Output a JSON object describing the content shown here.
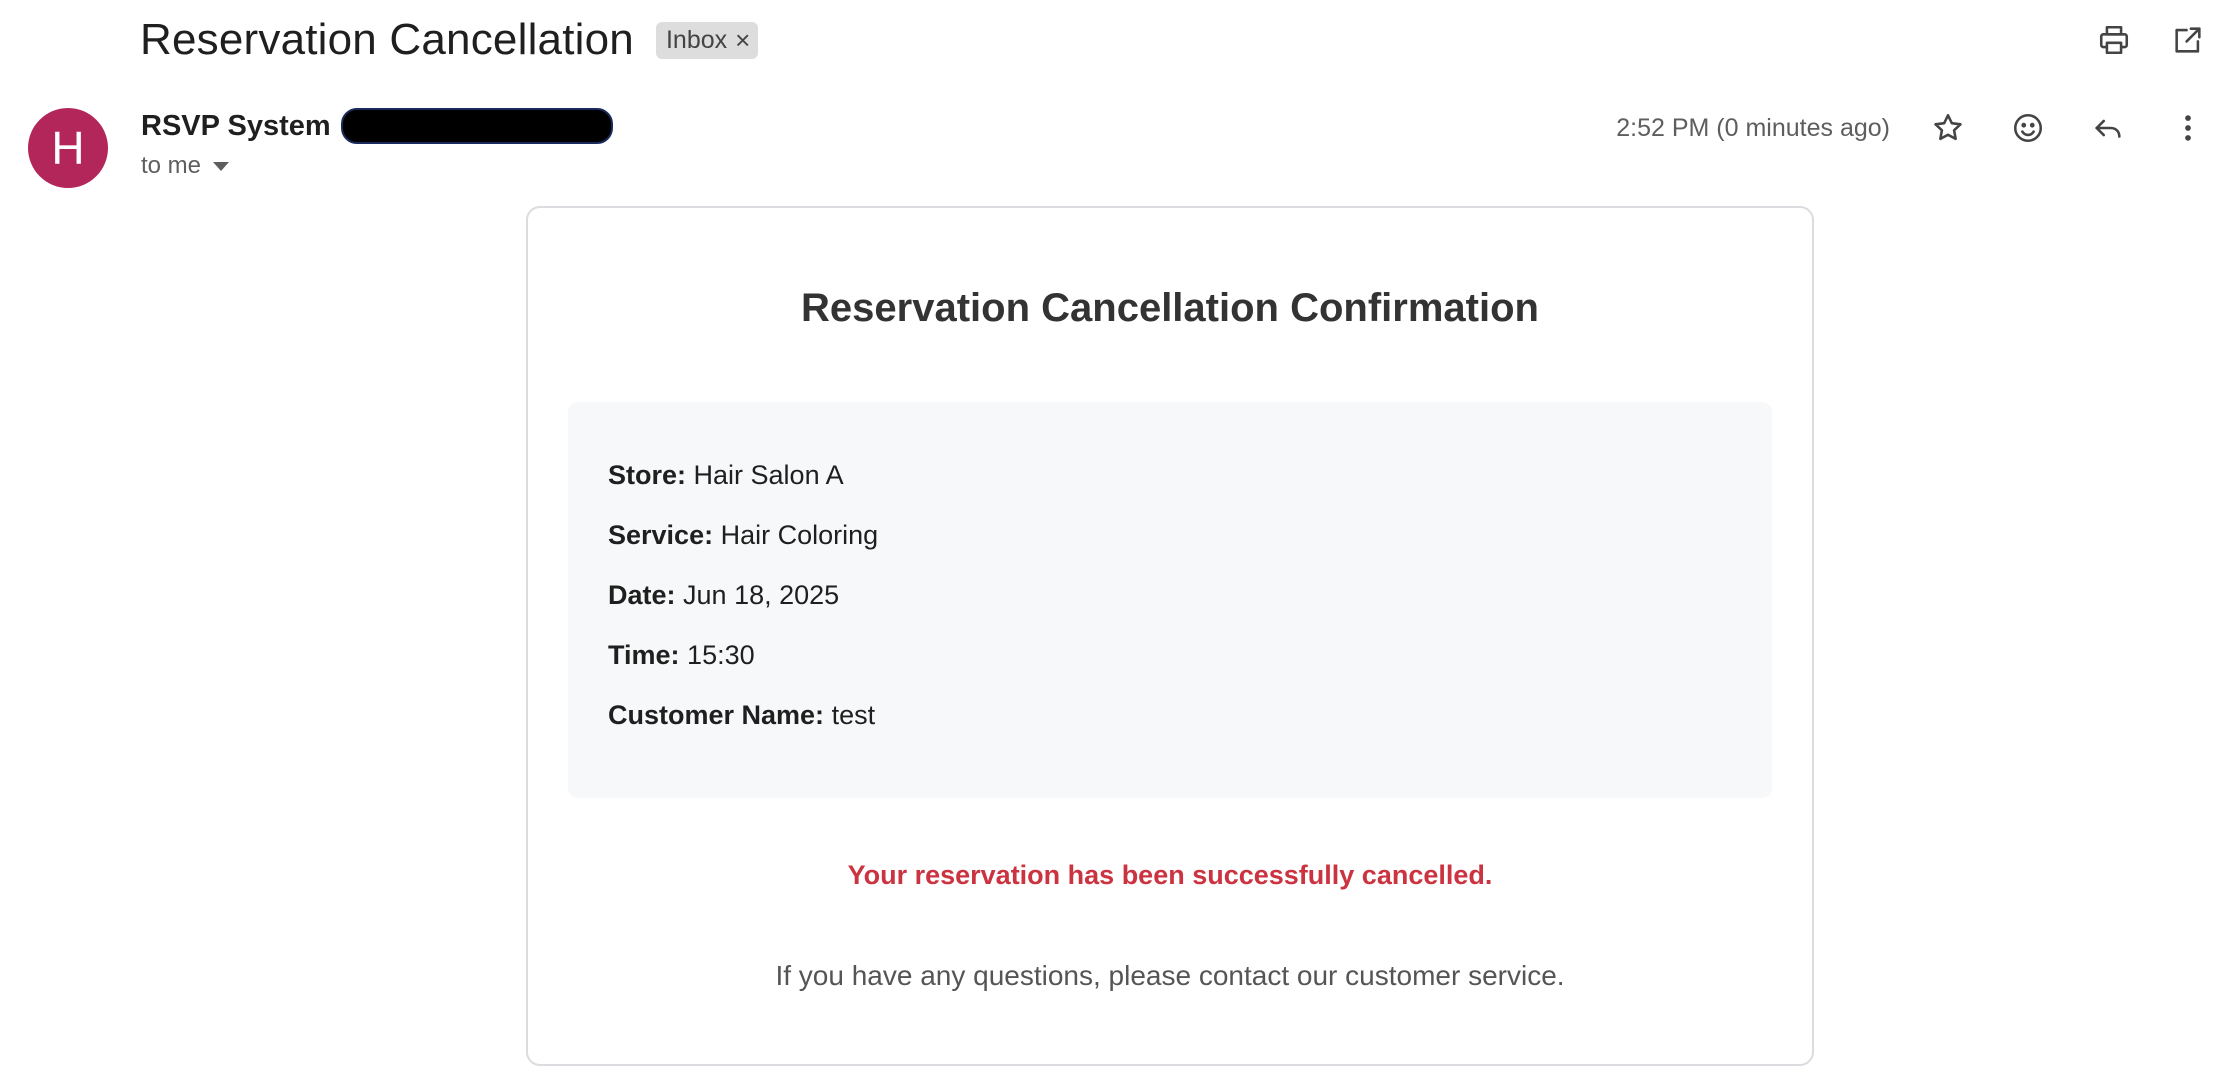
{
  "email": {
    "subject": "Reservation Cancellation",
    "label_chip": "Inbox",
    "sender": {
      "avatar_letter": "H",
      "name": "RSVP System",
      "recipient_text": "to me"
    },
    "timestamp": "2:52 PM (0 minutes ago)",
    "icons": {
      "print": "print-icon",
      "open_new_window": "open-in-new-icon",
      "star": "star-icon",
      "emoji": "emoji-icon",
      "reply": "reply-icon",
      "more": "more-vert-icon"
    },
    "colors": {
      "avatar": "#b3265a",
      "cancel_message": "#cc3340"
    }
  },
  "body": {
    "title": "Reservation Cancellation Confirmation",
    "details": [
      {
        "label": "Store:",
        "value": "Hair Salon A"
      },
      {
        "label": "Service:",
        "value": "Hair Coloring"
      },
      {
        "label": "Date:",
        "value": "Jun 18, 2025"
      },
      {
        "label": "Time:",
        "value": "15:30"
      },
      {
        "label": "Customer Name:",
        "value": "test"
      }
    ],
    "cancel_message": "Your reservation has been successfully cancelled.",
    "contact_message": "If you have any questions, please contact our customer service."
  }
}
